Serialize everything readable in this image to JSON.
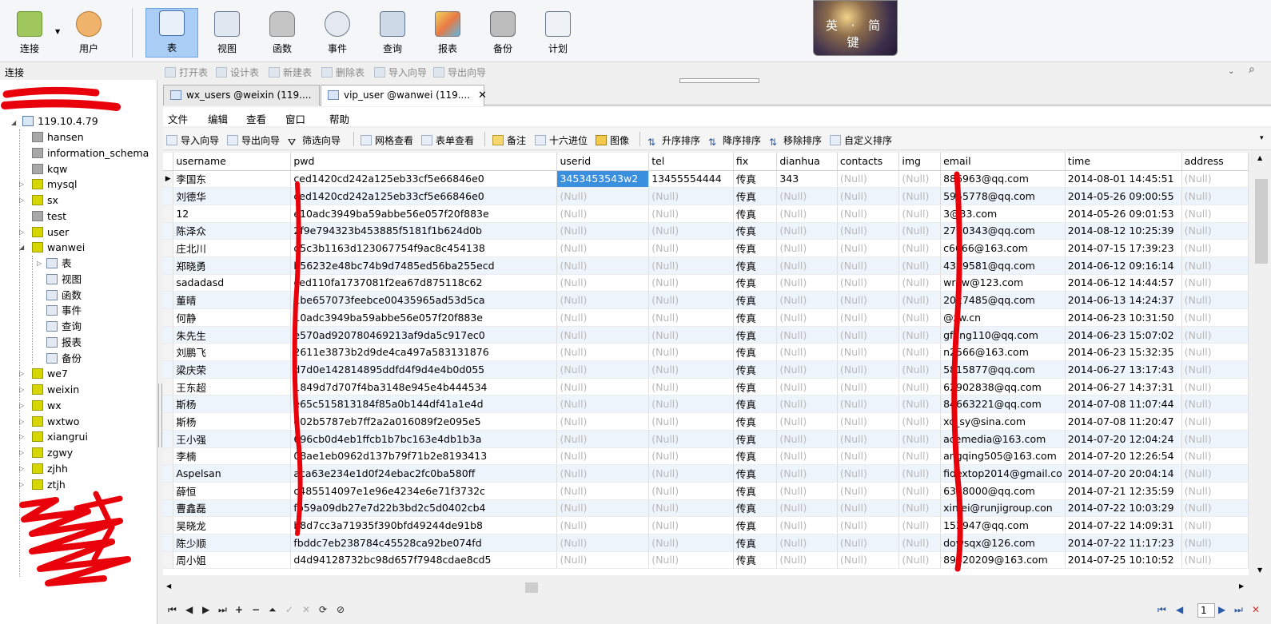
{
  "toolbar": {
    "buttons": [
      {
        "label": "连接",
        "icon": "plug-icon"
      },
      {
        "label": "用户",
        "icon": "user-icon"
      },
      {
        "label": "表",
        "icon": "table-icon"
      },
      {
        "label": "视图",
        "icon": "view-icon"
      },
      {
        "label": "函数",
        "icon": "function-icon"
      },
      {
        "label": "事件",
        "icon": "clock-icon"
      },
      {
        "label": "查询",
        "icon": "query-icon"
      },
      {
        "label": "报表",
        "icon": "report-icon"
      },
      {
        "label": "备份",
        "icon": "backup-icon"
      },
      {
        "label": "计划",
        "icon": "schedule-icon"
      }
    ],
    "ime_label": "英 · 简 键"
  },
  "left_panel": {
    "title": "连接",
    "server": "119.10.4.79",
    "databases": [
      {
        "name": "hansen",
        "open": false
      },
      {
        "name": "information_schema",
        "open": false
      },
      {
        "name": "kqw",
        "open": false
      },
      {
        "name": "mysql",
        "open": true
      },
      {
        "name": "sx",
        "open": true
      },
      {
        "name": "test",
        "open": false
      },
      {
        "name": "user",
        "open": true
      },
      {
        "name": "wanwei",
        "open": true
      },
      {
        "name": "we7",
        "open": true
      },
      {
        "name": "weixin",
        "open": true
      },
      {
        "name": "wx",
        "open": true
      },
      {
        "name": "wxtwo",
        "open": true
      },
      {
        "name": "xiangrui",
        "open": true
      },
      {
        "name": "zgwy",
        "open": true
      },
      {
        "name": "zjhh",
        "open": true
      },
      {
        "name": "ztjh",
        "open": true
      }
    ],
    "wanwei_children": [
      "表",
      "视图",
      "函数",
      "事件",
      "查询",
      "报表",
      "备份"
    ]
  },
  "object_toolbar": [
    "打开表",
    "设计表",
    "新建表",
    "删除表",
    "导入向导",
    "导出向导"
  ],
  "tabs": [
    {
      "label": "wx_users @weixin (119....",
      "active": false
    },
    {
      "label": "vip_user @wanwei (119....",
      "active": true
    }
  ],
  "menu": [
    "文件",
    "编辑",
    "查看",
    "窗口",
    "帮助"
  ],
  "grid_toolbar": [
    "导入向导",
    "导出向导",
    "筛选向导",
    "网格查看",
    "表单查看",
    "备注",
    "十六进位",
    "图像",
    "升序排序",
    "降序排序",
    "移除排序",
    "自定义排序"
  ],
  "grid": {
    "columns": [
      "username",
      "pwd",
      "userid",
      "tel",
      "fix",
      "dianhua",
      "contacts",
      "img",
      "email",
      "time",
      "address"
    ],
    "null_text": "(Null)",
    "rows": [
      [
        "李国东",
        "ced1420cd242a125eb33cf5e66846e0",
        "3453453543w2",
        "13455554444",
        "传真",
        "343",
        "(Null)",
        "(Null)",
        "886963@qq.com",
        "2014-08-01 14:45:51",
        "(Null)"
      ],
      [
        "刘德华",
        "ced1420cd242a125eb33cf5e66846e0",
        "(Null)",
        "(Null)",
        "传真",
        "(Null)",
        "(Null)",
        "(Null)",
        "5955778@qq.com",
        "2014-05-26 09:00:55",
        "(Null)"
      ],
      [
        "12",
        "e10adc3949ba59abbe56e057f20f883e",
        "(Null)",
        "(Null)",
        "传真",
        "(Null)",
        "(Null)",
        "(Null)",
        "3@33.com",
        "2014-05-26 09:01:53",
        "(Null)"
      ],
      [
        "陈泽众",
        "2f9e794323b453885f5181f1b624d0b",
        "(Null)",
        "(Null)",
        "传真",
        "(Null)",
        "(Null)",
        "(Null)",
        "2770343@qq.com",
        "2014-08-12 10:25:39",
        "(Null)"
      ],
      [
        "庄北川",
        "d5c3b1163d123067754f9ac8c454138",
        "(Null)",
        "(Null)",
        "传真",
        "(Null)",
        "(Null)",
        "(Null)",
        "c6666@163.com",
        "2014-07-15 17:39:23",
        "(Null)"
      ],
      [
        "郑晓勇",
        "b56232e48bc74b9d7485ed56ba255ecd",
        "(Null)",
        "(Null)",
        "传真",
        "(Null)",
        "(Null)",
        "(Null)",
        "4389581@qq.com",
        "2014-06-12 09:16:14",
        "(Null)"
      ],
      [
        "sadadasd",
        "ced110fa1737081f2ea67d875118c62",
        "(Null)",
        "(Null)",
        "传真",
        "(Null)",
        "(Null)",
        "(Null)",
        "wrew@123.com",
        "2014-06-12 14:44:57",
        "(Null)"
      ],
      [
        "董晴",
        "1be657073feebce00435965ad53d5ca",
        "(Null)",
        "(Null)",
        "传真",
        "(Null)",
        "(Null)",
        "(Null)",
        "2027485@qq.com",
        "2014-06-13 14:24:37",
        "(Null)"
      ],
      [
        "何静",
        "10adc3949ba59abbe56e057f20f883e",
        "(Null)",
        "(Null)",
        "传真",
        "(Null)",
        "(Null)",
        "(Null)",
        "@zw.cn",
        "2014-06-23 10:31:50",
        "(Null)"
      ],
      [
        "朱先生",
        "e570ad920780469213af9da5c917ec0",
        "(Null)",
        "(Null)",
        "传真",
        "(Null)",
        "(Null)",
        "(Null)",
        "gfeng110@qq.com",
        "2014-06-23 15:07:02",
        "(Null)"
      ],
      [
        "刘鹏飞",
        "2611e3873b2d9de4ca497a583131876",
        "(Null)",
        "(Null)",
        "传真",
        "(Null)",
        "(Null)",
        "(Null)",
        "n2566@163.com",
        "2014-06-23 15:32:35",
        "(Null)"
      ],
      [
        "梁庆荣",
        "d7d0e142814895ddfd4f9d4e4b0d055",
        "(Null)",
        "(Null)",
        "传真",
        "(Null)",
        "(Null)",
        "(Null)",
        "5815877@qq.com",
        "2014-06-27 13:17:43",
        "(Null)"
      ],
      [
        "王东超",
        "1849d7d707f4ba3148e945e4b444534",
        "(Null)",
        "(Null)",
        "传真",
        "(Null)",
        "(Null)",
        "(Null)",
        "62902838@qq.com",
        "2014-06-27 14:37:31",
        "(Null)"
      ],
      [
        "斯杨",
        "e65c515813184f85a0b144df41a1e4d",
        "(Null)",
        "(Null)",
        "传真",
        "(Null)",
        "(Null)",
        "(Null)",
        "84663221@qq.com",
        "2014-07-08 11:07:44",
        "(Null)"
      ],
      [
        "斯杨",
        "d02b5787eb7ff2a2a016089f2e095e5",
        "(Null)",
        "(Null)",
        "传真",
        "(Null)",
        "(Null)",
        "(Null)",
        "xc_sy@sina.com",
        "2014-07-08 11:20:47",
        "(Null)"
      ],
      [
        "王小强",
        "696cb0d4eb1ffcb1b7bc163e4db1b3a",
        "(Null)",
        "(Null)",
        "传真",
        "(Null)",
        "(Null)",
        "(Null)",
        "acemedia@163.com",
        "2014-07-20 12:04:24",
        "(Null)"
      ],
      [
        "李楠",
        "08ae1eb0962d137b79f71b2e8193413",
        "(Null)",
        "(Null)",
        "传真",
        "(Null)",
        "(Null)",
        "(Null)",
        "angqing505@163.com",
        "2014-07-20 12:26:54",
        "(Null)"
      ],
      [
        "Aspelsan",
        "aca63e234e1d0f24ebac2fc0ba580ff",
        "(Null)",
        "(Null)",
        "传真",
        "(Null)",
        "(Null)",
        "(Null)",
        "fidextop2014@gmail.co",
        "2014-07-20 20:04:14",
        "(Null)"
      ],
      [
        "薛恒",
        "c485514097e1e96e4234e6e71f3732c",
        "(Null)",
        "(Null)",
        "传真",
        "(Null)",
        "(Null)",
        "(Null)",
        "6378000@qq.com",
        "2014-07-21 12:35:59",
        "(Null)"
      ],
      [
        "曹鑫磊",
        "fb59a09db27e7d22b3bd2c5d0402cb4",
        "(Null)",
        "(Null)",
        "传真",
        "(Null)",
        "(Null)",
        "(Null)",
        "xinlei@runjigroup.con",
        "2014-07-22 10:03:29",
        "(Null)"
      ],
      [
        "吴晓龙",
        "b8d7cc3a71935f390bfd49244de91b8",
        "(Null)",
        "(Null)",
        "传真",
        "(Null)",
        "(Null)",
        "(Null)",
        "152947@qq.com",
        "2014-07-22 14:09:31",
        "(Null)"
      ],
      [
        "陈少顺",
        "fbddc7eb238784c45528ca92be074fd",
        "(Null)",
        "(Null)",
        "传真",
        "(Null)",
        "(Null)",
        "(Null)",
        "dowsqx@126.com",
        "2014-07-22 11:17:23",
        "(Null)"
      ],
      [
        "周小姐",
        "d4d94128732bc98d657f7948cdae8cd5",
        "(Null)",
        "(Null)",
        "传真",
        "(Null)",
        "(Null)",
        "(Null)",
        "89420209@163.com",
        "2014-07-25 10:10:52",
        "(Null)"
      ]
    ]
  },
  "nav": {
    "page": "1"
  },
  "colors": {
    "selected_tool": "#a9cdf5",
    "selected_cell": "#3b8fdf",
    "redaction": "#e8000b",
    "null_text": "#b8b8b8"
  }
}
